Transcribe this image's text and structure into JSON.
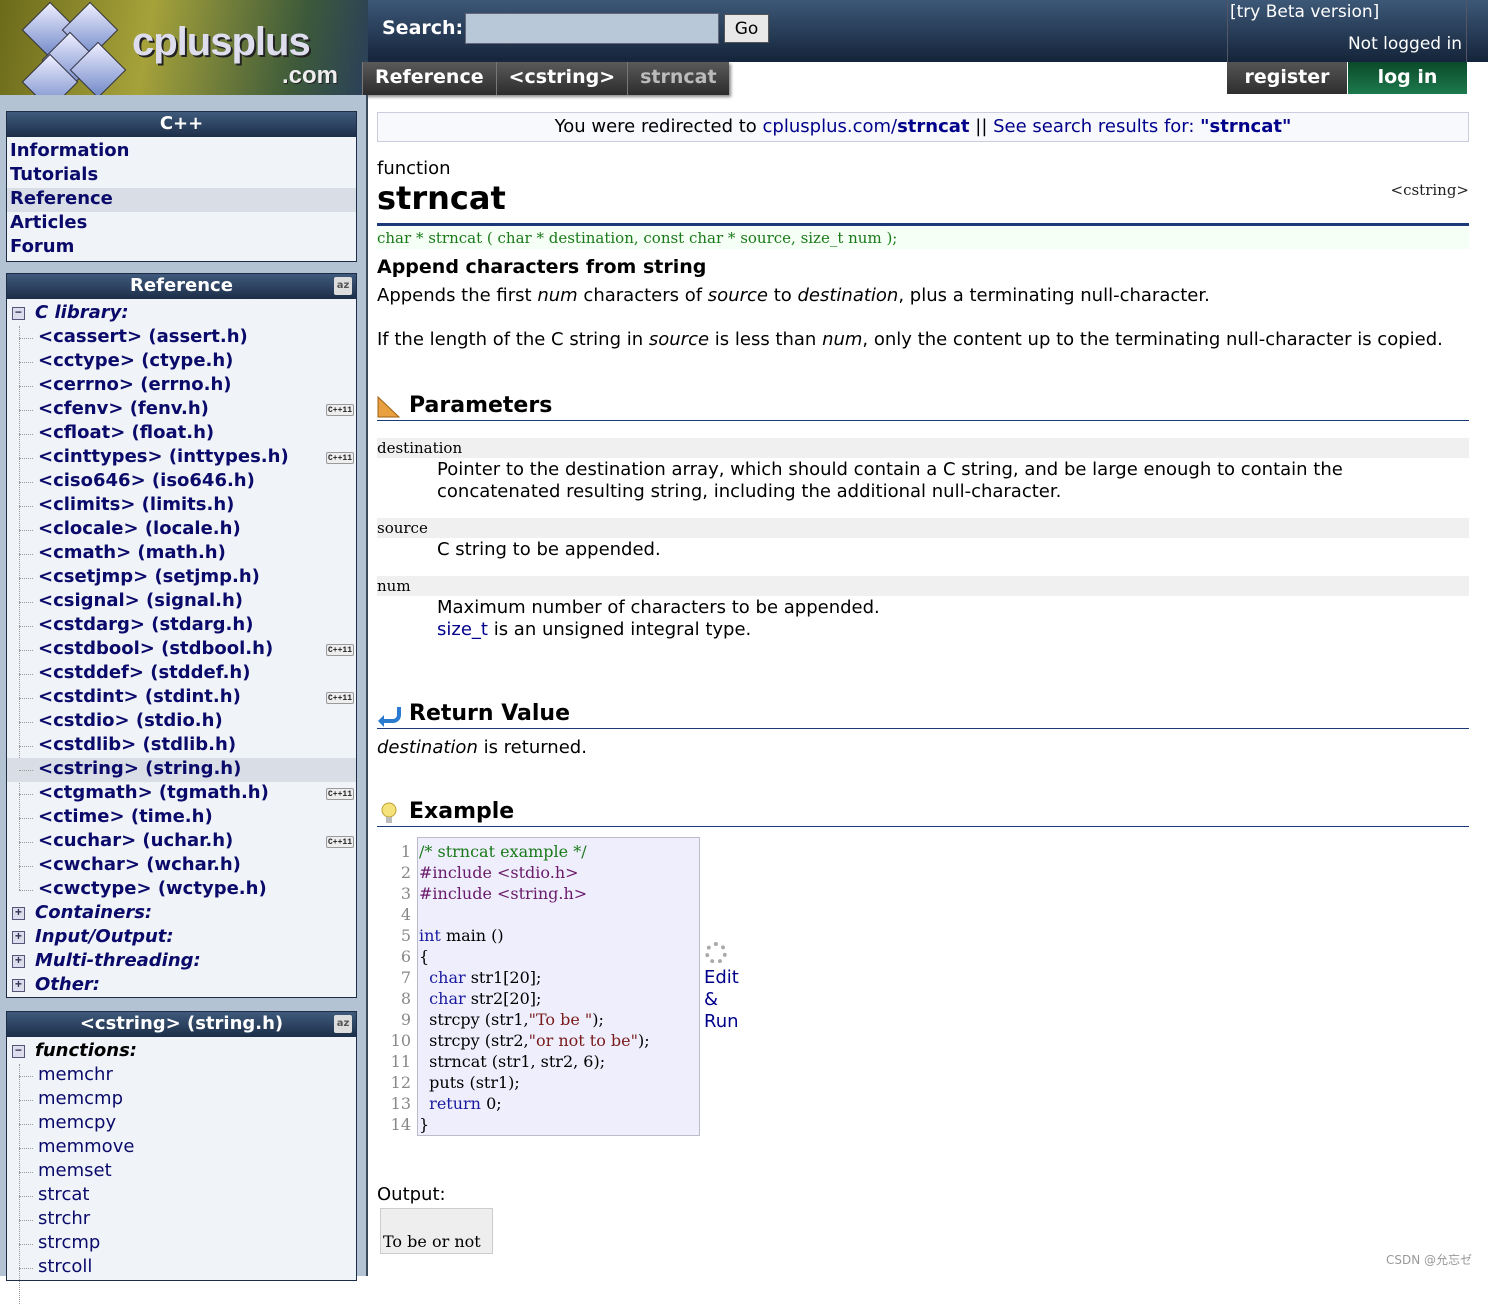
{
  "header": {
    "logo_text": "cplusplus",
    "logo_suffix": ".com",
    "search_label": "Search:",
    "search_value": "",
    "go_label": "Go",
    "beta_link": "[try Beta version]",
    "login_status": "Not logged in",
    "register": "register",
    "login": "log in",
    "breadcrumbs": [
      "Reference",
      "<cstring>",
      "strncat"
    ]
  },
  "sidebar": {
    "cpp_box": {
      "title": "C++",
      "items": [
        "Information",
        "Tutorials",
        "Reference",
        "Articles",
        "Forum"
      ],
      "selected": "Reference"
    },
    "reference_box": {
      "title": "Reference",
      "sort_icon": "a-z-sort-icon",
      "group": "C library:",
      "items": [
        {
          "label": "<cassert> (assert.h)"
        },
        {
          "label": "<cctype> (ctype.h)"
        },
        {
          "label": "<cerrno> (errno.h)"
        },
        {
          "label": "<cfenv> (fenv.h)",
          "badge": "C++11"
        },
        {
          "label": "<cfloat> (float.h)"
        },
        {
          "label": "<cinttypes> (inttypes.h)",
          "badge": "C++11"
        },
        {
          "label": "<ciso646> (iso646.h)"
        },
        {
          "label": "<climits> (limits.h)"
        },
        {
          "label": "<clocale> (locale.h)"
        },
        {
          "label": "<cmath> (math.h)"
        },
        {
          "label": "<csetjmp> (setjmp.h)"
        },
        {
          "label": "<csignal> (signal.h)"
        },
        {
          "label": "<cstdarg> (stdarg.h)"
        },
        {
          "label": "<cstdbool> (stdbool.h)",
          "badge": "C++11"
        },
        {
          "label": "<cstddef> (stddef.h)"
        },
        {
          "label": "<cstdint> (stdint.h)",
          "badge": "C++11"
        },
        {
          "label": "<cstdio> (stdio.h)"
        },
        {
          "label": "<cstdlib> (stdlib.h)"
        },
        {
          "label": "<cstring> (string.h)",
          "selected": true
        },
        {
          "label": "<ctgmath> (tgmath.h)",
          "badge": "C++11"
        },
        {
          "label": "<ctime> (time.h)"
        },
        {
          "label": "<cuchar> (uchar.h)",
          "badge": "C++11"
        },
        {
          "label": "<cwchar> (wchar.h)"
        },
        {
          "label": "<cwctype> (wctype.h)"
        }
      ],
      "collapsed_groups": [
        "Containers:",
        "Input/Output:",
        "Multi-threading:",
        "Other:"
      ]
    },
    "cstring_box": {
      "title": "<cstring> (string.h)",
      "group": "functions:",
      "items": [
        "memchr",
        "memcmp",
        "memcpy",
        "memmove",
        "memset",
        "strcat",
        "strchr",
        "strcmp",
        "strcoll"
      ]
    }
  },
  "main": {
    "redirect": {
      "prefix": "You were redirected to ",
      "link_base": "cplusplus.com/",
      "link_bold": "strncat",
      "sep": " || ",
      "search_text": "See search results for: ",
      "search_term": "\"strncat\""
    },
    "kind": "function",
    "title": "strncat",
    "header_file": "<cstring>",
    "prototype": "char * strncat ( char * destination, const char * source, size_t num );",
    "summary": "Append characters from string",
    "desc1": [
      "Appends the first ",
      "num",
      " characters of ",
      "source",
      " to ",
      "destination",
      ", plus a terminating null-character."
    ],
    "desc2": [
      "If the length of the C string in ",
      "source",
      " is less than ",
      "num",
      ", only the content up to the terminating null-character is copied."
    ],
    "parameters_title": "Parameters",
    "params": [
      {
        "name": "destination",
        "desc": "Pointer to the destination array, which should contain a C string, and be large enough to contain the",
        "desc2": "concatenated resulting string, including the additional null-character."
      },
      {
        "name": "source",
        "desc": "C string to be appended."
      },
      {
        "name": "num",
        "desc": "Maximum number of characters to be appended.",
        "link": "size_t",
        "desc2": " is an unsigned integral type."
      }
    ],
    "return_title": "Return Value",
    "return_value": [
      "destination",
      " is returned."
    ],
    "example_title": "Example",
    "code": [
      [
        [
          "c-cm",
          "/* strncat example */"
        ]
      ],
      [
        [
          "c-pp",
          "#include <stdio.h>"
        ]
      ],
      [
        [
          "c-pp",
          "#include <string.h>"
        ]
      ],
      [],
      [
        [
          "c-kw",
          "int"
        ],
        [
          "c-tx",
          " main ()"
        ]
      ],
      [
        [
          "c-tx",
          "{"
        ]
      ],
      [
        [
          "c-tx",
          "  "
        ],
        [
          "c-kw",
          "char"
        ],
        [
          "c-tx",
          " str1[20];"
        ]
      ],
      [
        [
          "c-tx",
          "  "
        ],
        [
          "c-kw",
          "char"
        ],
        [
          "c-tx",
          " str2[20];"
        ]
      ],
      [
        [
          "c-tx",
          "  strcpy (str1,"
        ],
        [
          "c-st",
          "\"To be \""
        ],
        [
          "c-tx",
          ");"
        ]
      ],
      [
        [
          "c-tx",
          "  strcpy (str2,"
        ],
        [
          "c-st",
          "\"or not to be\""
        ],
        [
          "c-tx",
          ");"
        ]
      ],
      [
        [
          "c-tx",
          "  strncat (str1, str2, 6);"
        ]
      ],
      [
        [
          "c-tx",
          "  puts (str1);"
        ]
      ],
      [
        [
          "c-tx",
          "  "
        ],
        [
          "c-kw",
          "return"
        ],
        [
          "c-tx",
          " 0;"
        ]
      ],
      [
        [
          "c-tx",
          "}"
        ]
      ]
    ],
    "edit_run": [
      "Edit",
      "&",
      "Run"
    ],
    "output_label": "Output:",
    "output": "To be or not"
  },
  "watermark": "CSDN @允忘ゼ"
}
